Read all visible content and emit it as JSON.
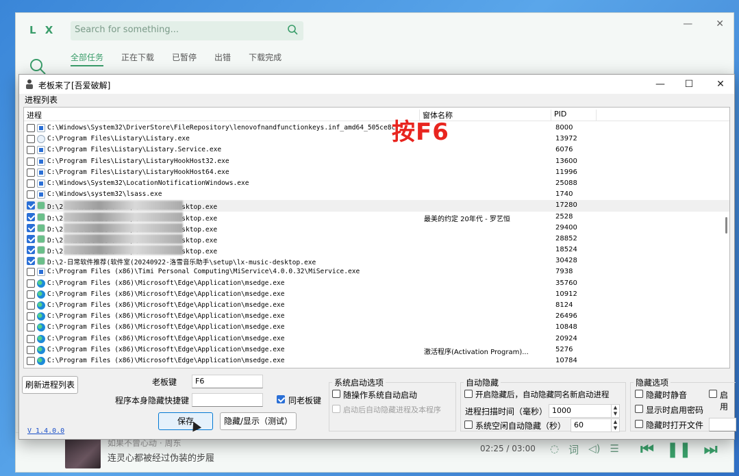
{
  "lx_app": {
    "logo": "L X",
    "search_placeholder": "Search for something...",
    "tabs": [
      "全部任务",
      "正在下载",
      "已暂停",
      "出错",
      "下载完成"
    ],
    "player": {
      "song": "如果不曾心动 · 周东",
      "lyric": "连灵心都被经过伪装的步履",
      "time": "02:25 / 03:00"
    }
  },
  "dialog": {
    "title": "老板来了[吾爱破解]",
    "list_label": "进程列表",
    "columns": {
      "process": "进程",
      "window": "窗体名称",
      "pid": "PID"
    },
    "overlay": "按F6",
    "rows": [
      {
        "checked": false,
        "icon": "windows",
        "path": "C:\\Windows\\System32\\DriverStore\\FileRepository\\lenovofnandfunctionkeys.inf_amd64_505ce8c",
        "window": "",
        "pid": "8000",
        "blur": false
      },
      {
        "checked": false,
        "icon": "listary",
        "path": "C:\\Program Files\\Listary\\Listary.exe",
        "window": "",
        "pid": "13972",
        "blur": false
      },
      {
        "checked": false,
        "icon": "windows",
        "path": "C:\\Program Files\\Listary\\Listary.Service.exe",
        "window": "",
        "pid": "6076",
        "blur": false
      },
      {
        "checked": false,
        "icon": "windows",
        "path": "C:\\Program Files\\Listary\\ListaryHookHost32.exe",
        "window": "",
        "pid": "13600",
        "blur": false
      },
      {
        "checked": false,
        "icon": "windows",
        "path": "C:\\Program Files\\Listary\\ListaryHookHost64.exe",
        "window": "",
        "pid": "11996",
        "blur": false
      },
      {
        "checked": false,
        "icon": "windows",
        "path": "C:\\Windows\\System32\\LocationNotificationWindows.exe",
        "window": "",
        "pid": "25088",
        "blur": false
      },
      {
        "checked": false,
        "icon": "windows",
        "path": "C:\\Windows\\system32\\lsass.exe",
        "window": "",
        "pid": "1740",
        "blur": false
      },
      {
        "checked": true,
        "icon": "lx",
        "path": "D:\\2-                              洛雪音乐助手\\setup\\lx-music-desktop.exe",
        "window": "",
        "pid": "17280",
        "blur": true,
        "sel": true
      },
      {
        "checked": true,
        "icon": "lx",
        "path": "D:\\2-                              洛雪音乐助手\\setup\\lx-music-desktop.exe",
        "window": "最美的约定 20年代 - 罗艺恒",
        "pid": "2528",
        "blur": true
      },
      {
        "checked": true,
        "icon": "lx",
        "path": "D:\\2-                              洛雪音乐助手\\setup\\lx-music-desktop.exe",
        "window": "",
        "pid": "29400",
        "blur": true
      },
      {
        "checked": true,
        "icon": "lx",
        "path": "D:\\2-                              洛雪音乐助手\\setup\\lx-music-desktop.exe",
        "window": "",
        "pid": "28852",
        "blur": true
      },
      {
        "checked": true,
        "icon": "lx",
        "path": "D:\\2-                              洛雪音乐助手\\setup\\lx-music-desktop.exe",
        "window": "",
        "pid": "18524",
        "blur": true
      },
      {
        "checked": true,
        "icon": "lx",
        "path": "D:\\2-日常软件推荐(软件室(20240922-洛雪音乐助手\\setup\\lx-music-desktop.exe",
        "window": "",
        "pid": "30428",
        "blur": false
      },
      {
        "checked": false,
        "icon": "windows",
        "path": "C:\\Program Files (x86)\\Timi Personal Computing\\MiService\\4.0.0.32\\MiService.exe",
        "window": "",
        "pid": "7938",
        "blur": false
      },
      {
        "checked": false,
        "icon": "edge",
        "path": "C:\\Program Files (x86)\\Microsoft\\Edge\\Application\\msedge.exe",
        "window": "",
        "pid": "35760",
        "blur": false
      },
      {
        "checked": false,
        "icon": "edge",
        "path": "C:\\Program Files (x86)\\Microsoft\\Edge\\Application\\msedge.exe",
        "window": "",
        "pid": "10912",
        "blur": false
      },
      {
        "checked": false,
        "icon": "edge",
        "path": "C:\\Program Files (x86)\\Microsoft\\Edge\\Application\\msedge.exe",
        "window": "",
        "pid": "8124",
        "blur": false
      },
      {
        "checked": false,
        "icon": "edge",
        "path": "C:\\Program Files (x86)\\Microsoft\\Edge\\Application\\msedge.exe",
        "window": "",
        "pid": "26496",
        "blur": false
      },
      {
        "checked": false,
        "icon": "edge",
        "path": "C:\\Program Files (x86)\\Microsoft\\Edge\\Application\\msedge.exe",
        "window": "",
        "pid": "10848",
        "blur": false
      },
      {
        "checked": false,
        "icon": "edge",
        "path": "C:\\Program Files (x86)\\Microsoft\\Edge\\Application\\msedge.exe",
        "window": "",
        "pid": "20924",
        "blur": false
      },
      {
        "checked": false,
        "icon": "edge",
        "path": "C:\\Program Files (x86)\\Microsoft\\Edge\\Application\\msedge.exe",
        "window": "激活程序(Activation Program)...",
        "pid": "5276",
        "blur": false
      },
      {
        "checked": false,
        "icon": "edge",
        "path": "C:\\Program Files (x86)\\Microsoft\\Edge\\Application\\msedge.exe",
        "window": "",
        "pid": "10784",
        "blur": false
      }
    ],
    "controls": {
      "refresh_label": "刷新进程列表",
      "boss_key_label": "老板键",
      "boss_key_value": "F6",
      "self_hide_label": "程序本身隐藏快捷键",
      "self_hide_value": "",
      "same_as_boss_label": "同老板键",
      "same_as_boss_checked": true,
      "save_label": "保存",
      "toggle_label": "隐藏/显示（测试）",
      "version": "V 1.4.0.0"
    },
    "startup_group": {
      "title": "系统启动选项",
      "opt1": "随操作系统自动启动",
      "opt2": "启动后自动隐藏进程及本程序"
    },
    "autohide_group": {
      "title": "自动隐藏",
      "opt1": "开启隐藏后，自动隐藏同名新启动进程",
      "scan_label": "进程扫描时间（毫秒）",
      "scan_value": "1000",
      "idle_label": "系统空闲自动隐藏（秒）",
      "idle_value": "60"
    },
    "hide_group": {
      "title": "隐藏选项",
      "mute": "隐藏时静音",
      "password": "显示时启用密码",
      "openfile": "隐藏时打开文件",
      "enable": "启用"
    }
  }
}
